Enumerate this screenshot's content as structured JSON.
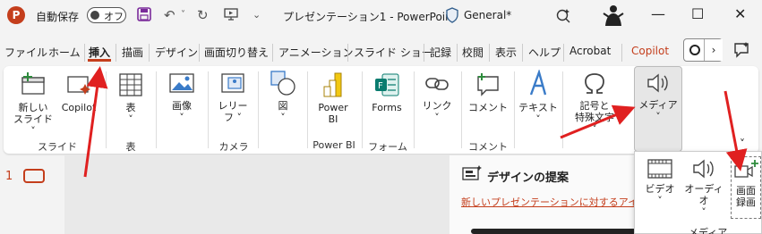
{
  "titlebar": {
    "logo_letter": "P",
    "autosave_label": "自動保存",
    "autosave_state": "オフ",
    "doc_title": "プレゼンテーション1 - PowerPoint",
    "sensitivity_label": "General*"
  },
  "tabs": [
    {
      "label": "ファイル"
    },
    {
      "label": "ホーム"
    },
    {
      "label": "挿入"
    },
    {
      "label": "描画"
    },
    {
      "label": "デザイン"
    },
    {
      "label": "画面切り替え"
    },
    {
      "label": "アニメーション"
    },
    {
      "label": "スライド ショー"
    },
    {
      "label": "記録"
    },
    {
      "label": "校閲"
    },
    {
      "label": "表示"
    },
    {
      "label": "ヘルプ"
    },
    {
      "label": "Acrobat"
    },
    {
      "label": "Copilot"
    }
  ],
  "ribbon": {
    "new_slide_1": "新しい",
    "new_slide_2": "スライド ˅",
    "copilot": "Copilot",
    "group_slides": "スライド",
    "table": "表",
    "table_drop": "˅",
    "group_table": "表",
    "image": "画像",
    "image_drop": "˅",
    "cameo_1": "レリー",
    "cameo_2": "フ ˅",
    "shapes": "図",
    "shapes_drop": "˅",
    "group_camera": "カメラ",
    "powerbi_1": "Power",
    "powerbi_2": "BI",
    "group_powerbi": "Power BI",
    "forms": "Forms",
    "group_forms": "フォーム",
    "link": "リンク",
    "link_drop": "˅",
    "comment": "コメント",
    "group_comment": "コメント",
    "text": "テキスト",
    "text_drop": "˅",
    "symbols_1": "記号と",
    "symbols_2": "特殊文字",
    "symbols_drop": "˅",
    "media": "メディア",
    "media_drop": "˅",
    "collapse": "˅"
  },
  "workspace": {
    "slide_number": "1",
    "design_title": "デザインの提案",
    "design_link": "新しいプレゼンテーションに対するアイデア..."
  },
  "media_menu": {
    "video": "ビデオ",
    "video_drop": "˅",
    "audio": "オーディオ",
    "audio_drop": "˅",
    "screen_rec_1": "画面",
    "screen_rec_2": "録画",
    "group": "メディア"
  },
  "colors": {
    "accent": "#c43e1c",
    "annotation_arrow": "#e02020"
  }
}
